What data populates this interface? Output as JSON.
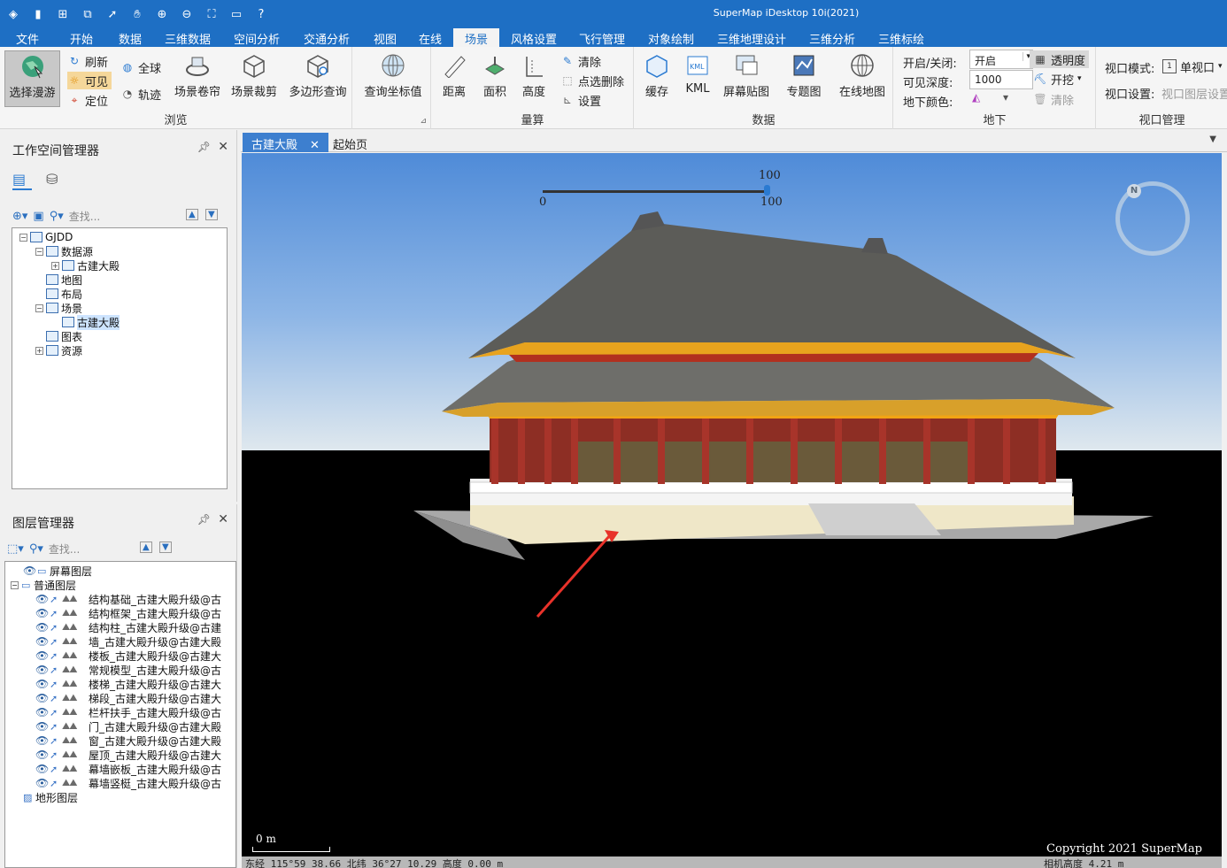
{
  "app": {
    "title": "SuperMap iDesktop 10i(2021)"
  },
  "quick_access": [
    "app-logo-icon",
    "save-icon",
    "new-window-icon",
    "window-icon",
    "pointer-icon",
    "hand-icon",
    "zoom-in-icon",
    "zoom-out-icon",
    "full-extent-icon",
    "open-folder-icon",
    "help-icon"
  ],
  "menu_tabs": [
    {
      "label": "文件",
      "w": 62
    },
    {
      "label": "开始",
      "w": 60
    },
    {
      "label": "数据",
      "w": 50
    },
    {
      "label": "三维数据",
      "w": 80
    },
    {
      "label": "空间分析",
      "w": 76
    },
    {
      "label": "交通分析",
      "w": 82
    },
    {
      "label": "视图",
      "w": 50
    },
    {
      "label": "在线",
      "w": 52
    },
    {
      "label": "场景",
      "w": 52
    },
    {
      "label": "风格设置",
      "w": 78
    },
    {
      "label": "飞行管理",
      "w": 76
    },
    {
      "label": "对象绘制",
      "w": 80
    },
    {
      "label": "三维地理设计",
      "w": 102
    },
    {
      "label": "三维分析",
      "w": 80
    },
    {
      "label": "三维标绘",
      "w": 76
    }
  ],
  "ribbon": {
    "browse": {
      "label": "浏览",
      "select_roam": "选择漫游",
      "refresh": "刷新",
      "visible": "可见",
      "locate": "定位",
      "globe": "全球",
      "track": "轨迹",
      "scene_roll": "场景卷帘",
      "scene_clip": "场景裁剪",
      "polygon_query": "多边形查询"
    },
    "query_coords": "查询坐标值",
    "measure": {
      "label": "量算",
      "distance": "距离",
      "area": "面积",
      "height": "高度",
      "clear": "清除",
      "point_delete": "点选删除",
      "settings": "设置"
    },
    "data": {
      "label": "数据",
      "cache": "缓存",
      "kml": "KML",
      "screen_map": "屏幕贴图",
      "thematic": "专题图",
      "online_map": "在线地图"
    },
    "underground": {
      "label": "地下",
      "on_off_label": "开启/关闭:",
      "on_off_value": "开启",
      "depth_label": "可见深度:",
      "depth_value": "1000",
      "color_label": "地下颜色:",
      "transparency": "透明度",
      "excavate": "开挖",
      "clear": "清除"
    },
    "viewport": {
      "label": "视口管理",
      "mode_label": "视口模式:",
      "mode_value": "单视口",
      "settings_label": "视口设置:",
      "settings_value": "视口图层设置"
    }
  },
  "workspace_manager": {
    "title": "工作空间管理器",
    "search_placeholder": "查找...",
    "tree": [
      {
        "label": "GJDD",
        "level": 0,
        "exp": "−"
      },
      {
        "label": "数据源",
        "level": 1,
        "exp": "−"
      },
      {
        "label": "古建大殿",
        "level": 2,
        "exp": "+"
      },
      {
        "label": "地图",
        "level": 1,
        "exp": ""
      },
      {
        "label": "布局",
        "level": 1,
        "exp": ""
      },
      {
        "label": "场景",
        "level": 1,
        "exp": "−"
      },
      {
        "label": "古建大殿",
        "level": 2,
        "exp": "",
        "hl": true
      },
      {
        "label": "图表",
        "level": 1,
        "exp": ""
      },
      {
        "label": "资源",
        "level": 1,
        "exp": "+"
      }
    ]
  },
  "layer_manager": {
    "title": "图层管理器",
    "search_placeholder": "查找...",
    "screen_layer": "屏幕图层",
    "normal_layer": "普通图层",
    "terrain_layer": "地形图层",
    "layers": [
      "结构基础_古建大殿升级@古",
      "结构框架_古建大殿升级@古",
      "结构柱_古建大殿升级@古建",
      "墙_古建大殿升级@古建大殿",
      "楼板_古建大殿升级@古建大",
      "常规模型_古建大殿升级@古",
      "楼梯_古建大殿升级@古建大",
      "梯段_古建大殿升级@古建大",
      "栏杆扶手_古建大殿升级@古",
      "门_古建大殿升级@古建大殿",
      "窗_古建大殿升级@古建大殿",
      "屋顶_古建大殿升级@古建大",
      "幕墙嵌板_古建大殿升级@古",
      "幕墙竖梃_古建大殿升级@古"
    ]
  },
  "doc_tabs": [
    {
      "label": "古建大殿",
      "active": true
    },
    {
      "label": "起始页",
      "active": false
    }
  ],
  "viewport": {
    "slider_min": "0",
    "slider_max": "100",
    "slider_value": "100",
    "scale_label": "0 m",
    "copyright": "Copyright 2021 SuperMap",
    "status_line1": "东经 115°59   38.66  北纬 36°27   10.29  高度 0.00 m",
    "status_line2": "相机高度 4.21 m",
    "compass": "N",
    "colors": {
      "ribbon_blue": "#1e6fc4",
      "arrow": "#e8322a"
    }
  }
}
